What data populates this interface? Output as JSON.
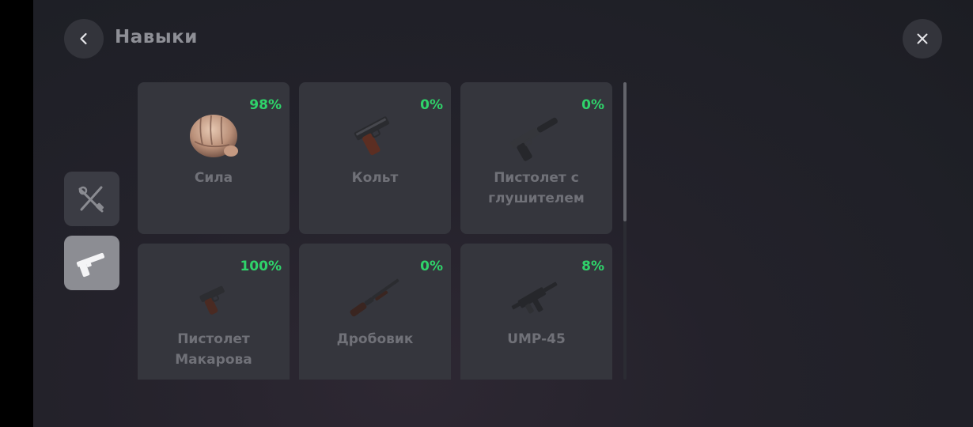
{
  "header": {
    "title": "Навыки",
    "back_icon": "chevron-left-icon",
    "close_icon": "close-icon"
  },
  "tabs": [
    {
      "icon": "tools-icon",
      "active": false
    },
    {
      "icon": "pistol-icon",
      "active": true
    }
  ],
  "skills": [
    {
      "name": "Сила",
      "percent": "98%",
      "icon": "fist-icon"
    },
    {
      "name": "Кольт",
      "percent": "0%",
      "icon": "colt-pistol-icon"
    },
    {
      "name": "Пистолет с глушителем",
      "percent": "0%",
      "icon": "silenced-pistol-icon"
    },
    {
      "name": "Пистолет Макарова",
      "percent": "100%",
      "icon": "makarov-pistol-icon"
    },
    {
      "name": "Дробовик",
      "percent": "0%",
      "icon": "shotgun-icon"
    },
    {
      "name": "UMP-45",
      "percent": "8%",
      "icon": "smg-icon"
    }
  ],
  "colors": {
    "percent": "#2fd36a",
    "card_bg": "#35363d",
    "label": "#707178",
    "active_tab": "#8c8d93"
  }
}
